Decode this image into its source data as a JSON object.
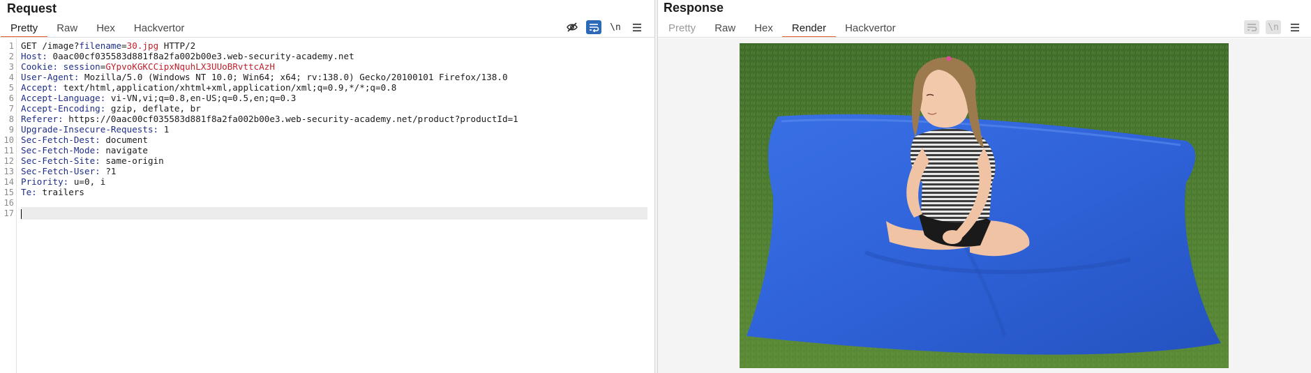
{
  "request": {
    "title": "Request",
    "tabs": [
      {
        "label": "Pretty",
        "active": true
      },
      {
        "label": "Raw",
        "active": false
      },
      {
        "label": "Hex",
        "active": false
      },
      {
        "label": "Hackvertor",
        "active": false
      }
    ],
    "toolbar": {
      "hide_icon": "eye-slash-icon",
      "wrap_icon": "word-wrap-icon",
      "newline_label": "\\n",
      "menu_icon": "hamburger-menu-icon"
    },
    "lines": [
      {
        "n": "1",
        "key": "GET /image?",
        "sep": "",
        "pname": "filename",
        "eq": "=",
        "pval": "30.jpg",
        "rest": " HTTP/2"
      },
      {
        "n": "2",
        "key": "Host:",
        "rest": " 0aac00cf035583d881f8a2fa002b00e3.web-security-academy.net"
      },
      {
        "n": "3",
        "key": "Cookie:",
        "rest": " ",
        "pname": "session",
        "eq": "=",
        "pval": "GYpvoKGKCCipxNquhLX3UUoBRvttcAzH"
      },
      {
        "n": "4",
        "key": "User-Agent:",
        "rest": " Mozilla/5.0 (Windows NT 10.0; Win64; x64; rv:138.0) Gecko/20100101 Firefox/138.0"
      },
      {
        "n": "5",
        "key": "Accept:",
        "rest": " text/html,application/xhtml+xml,application/xml;q=0.9,*/*;q=0.8"
      },
      {
        "n": "6",
        "key": "Accept-Language:",
        "rest": " vi-VN,vi;q=0.8,en-US;q=0.5,en;q=0.3"
      },
      {
        "n": "7",
        "key": "Accept-Encoding:",
        "rest": " gzip, deflate, br"
      },
      {
        "n": "8",
        "key": "Referer:",
        "rest": " https://0aac00cf035583d881f8a2fa002b00e3.web-security-academy.net/product?productId=1"
      },
      {
        "n": "9",
        "key": "Upgrade-Insecure-Requests:",
        "rest": " 1"
      },
      {
        "n": "10",
        "key": "Sec-Fetch-Dest:",
        "rest": " document"
      },
      {
        "n": "11",
        "key": "Sec-Fetch-Mode:",
        "rest": " navigate"
      },
      {
        "n": "12",
        "key": "Sec-Fetch-Site:",
        "rest": " same-origin"
      },
      {
        "n": "13",
        "key": "Sec-Fetch-User:",
        "rest": " ?1"
      },
      {
        "n": "14",
        "key": "Priority:",
        "rest": " u=0, i"
      },
      {
        "n": "15",
        "key": "Te:",
        "rest": " trailers"
      },
      {
        "n": "16",
        "key": "",
        "rest": ""
      },
      {
        "n": "17",
        "key": "",
        "rest": ""
      }
    ],
    "current_line": "17"
  },
  "response": {
    "title": "Response",
    "tabs": [
      {
        "label": "Pretty",
        "active": false,
        "disabled": true
      },
      {
        "label": "Raw",
        "active": false
      },
      {
        "label": "Hex",
        "active": false
      },
      {
        "label": "Render",
        "active": true
      },
      {
        "label": "Hackvertor",
        "active": false
      }
    ],
    "toolbar": {
      "wrap_icon": "word-wrap-icon",
      "newline_label": "\\n",
      "menu_icon": "hamburger-menu-icon"
    },
    "image": "photo of girl sitting on blue bean bag cushion on grass"
  },
  "colors": {
    "accent": "#e8602c",
    "active_button": "#2c6ab8",
    "header_key": "#1e2d8a",
    "param_value": "#c0202b",
    "bean_bag": "#2f62d8"
  }
}
